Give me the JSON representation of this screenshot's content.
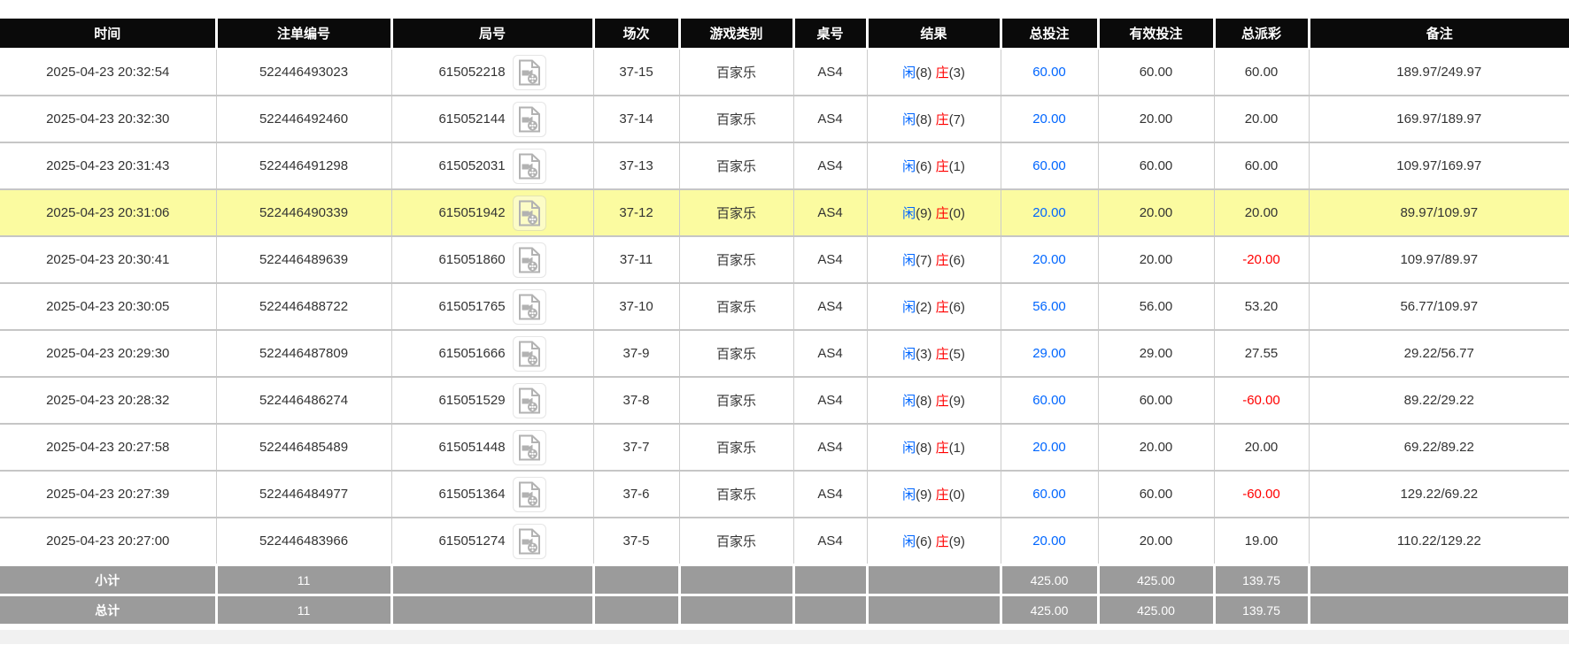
{
  "colors": {
    "header_bg": "#0a0a0a",
    "footer_bg": "#9b9b9b",
    "highlight_row_bg": "#fbfba0",
    "link_blue": "#0066ff",
    "banker_red": "#ff0000",
    "negative_red": "#ff0000",
    "grid_line": "#c6c6c6"
  },
  "icons": {
    "video_icon": "video-replay-icon"
  },
  "table": {
    "columns": [
      {
        "key": "time",
        "label": "时间"
      },
      {
        "key": "bet_id",
        "label": "注单编号"
      },
      {
        "key": "round_id",
        "label": "局号"
      },
      {
        "key": "session",
        "label": "场次"
      },
      {
        "key": "game",
        "label": "游戏类别"
      },
      {
        "key": "table_no",
        "label": "桌号"
      },
      {
        "key": "result",
        "label": "结果"
      },
      {
        "key": "total_bet",
        "label": "总投注"
      },
      {
        "key": "valid_bet",
        "label": "有效投注"
      },
      {
        "key": "payout",
        "label": "总派彩"
      },
      {
        "key": "remark",
        "label": "备注"
      }
    ],
    "result_labels": {
      "player": "闲",
      "banker": "庄"
    },
    "rows": [
      {
        "time": "2025-04-23 20:32:54",
        "bet_id": "522446493023",
        "round_id": "615052218",
        "session": "37-15",
        "game": "百家乐",
        "table_no": "AS4",
        "result": {
          "player": "8",
          "banker": "3"
        },
        "total_bet": "60.00",
        "valid_bet": "60.00",
        "payout": "60.00",
        "remark": "189.97/249.97",
        "highlighted": false
      },
      {
        "time": "2025-04-23 20:32:30",
        "bet_id": "522446492460",
        "round_id": "615052144",
        "session": "37-14",
        "game": "百家乐",
        "table_no": "AS4",
        "result": {
          "player": "8",
          "banker": "7"
        },
        "total_bet": "20.00",
        "valid_bet": "20.00",
        "payout": "20.00",
        "remark": "169.97/189.97",
        "highlighted": false
      },
      {
        "time": "2025-04-23 20:31:43",
        "bet_id": "522446491298",
        "round_id": "615052031",
        "session": "37-13",
        "game": "百家乐",
        "table_no": "AS4",
        "result": {
          "player": "6",
          "banker": "1"
        },
        "total_bet": "60.00",
        "valid_bet": "60.00",
        "payout": "60.00",
        "remark": "109.97/169.97",
        "highlighted": false
      },
      {
        "time": "2025-04-23 20:31:06",
        "bet_id": "522446490339",
        "round_id": "615051942",
        "session": "37-12",
        "game": "百家乐",
        "table_no": "AS4",
        "result": {
          "player": "9",
          "banker": "0"
        },
        "total_bet": "20.00",
        "valid_bet": "20.00",
        "payout": "20.00",
        "remark": "89.97/109.97",
        "highlighted": true
      },
      {
        "time": "2025-04-23 20:30:41",
        "bet_id": "522446489639",
        "round_id": "615051860",
        "session": "37-11",
        "game": "百家乐",
        "table_no": "AS4",
        "result": {
          "player": "7",
          "banker": "6"
        },
        "total_bet": "20.00",
        "valid_bet": "20.00",
        "payout": "-20.00",
        "remark": "109.97/89.97",
        "highlighted": false
      },
      {
        "time": "2025-04-23 20:30:05",
        "bet_id": "522446488722",
        "round_id": "615051765",
        "session": "37-10",
        "game": "百家乐",
        "table_no": "AS4",
        "result": {
          "player": "2",
          "banker": "6"
        },
        "total_bet": "56.00",
        "valid_bet": "56.00",
        "payout": "53.20",
        "remark": "56.77/109.97",
        "highlighted": false
      },
      {
        "time": "2025-04-23 20:29:30",
        "bet_id": "522446487809",
        "round_id": "615051666",
        "session": "37-9",
        "game": "百家乐",
        "table_no": "AS4",
        "result": {
          "player": "3",
          "banker": "5"
        },
        "total_bet": "29.00",
        "valid_bet": "29.00",
        "payout": "27.55",
        "remark": "29.22/56.77",
        "highlighted": false
      },
      {
        "time": "2025-04-23 20:28:32",
        "bet_id": "522446486274",
        "round_id": "615051529",
        "session": "37-8",
        "game": "百家乐",
        "table_no": "AS4",
        "result": {
          "player": "8",
          "banker": "9"
        },
        "total_bet": "60.00",
        "valid_bet": "60.00",
        "payout": "-60.00",
        "remark": "89.22/29.22",
        "highlighted": false
      },
      {
        "time": "2025-04-23 20:27:58",
        "bet_id": "522446485489",
        "round_id": "615051448",
        "session": "37-7",
        "game": "百家乐",
        "table_no": "AS4",
        "result": {
          "player": "8",
          "banker": "1"
        },
        "total_bet": "20.00",
        "valid_bet": "20.00",
        "payout": "20.00",
        "remark": "69.22/89.22",
        "highlighted": false
      },
      {
        "time": "2025-04-23 20:27:39",
        "bet_id": "522446484977",
        "round_id": "615051364",
        "session": "37-6",
        "game": "百家乐",
        "table_no": "AS4",
        "result": {
          "player": "9",
          "banker": "0"
        },
        "total_bet": "60.00",
        "valid_bet": "60.00",
        "payout": "-60.00",
        "remark": "129.22/69.22",
        "highlighted": false
      },
      {
        "time": "2025-04-23 20:27:00",
        "bet_id": "522446483966",
        "round_id": "615051274",
        "session": "37-5",
        "game": "百家乐",
        "table_no": "AS4",
        "result": {
          "player": "6",
          "banker": "9"
        },
        "total_bet": "20.00",
        "valid_bet": "20.00",
        "payout": "19.00",
        "remark": "110.22/129.22",
        "highlighted": false
      }
    ],
    "subtotal": {
      "label": "小计",
      "count": "11",
      "total_bet": "425.00",
      "valid_bet": "425.00",
      "payout": "139.75"
    },
    "total": {
      "label": "总计",
      "count": "11",
      "total_bet": "425.00",
      "valid_bet": "425.00",
      "payout": "139.75"
    }
  }
}
